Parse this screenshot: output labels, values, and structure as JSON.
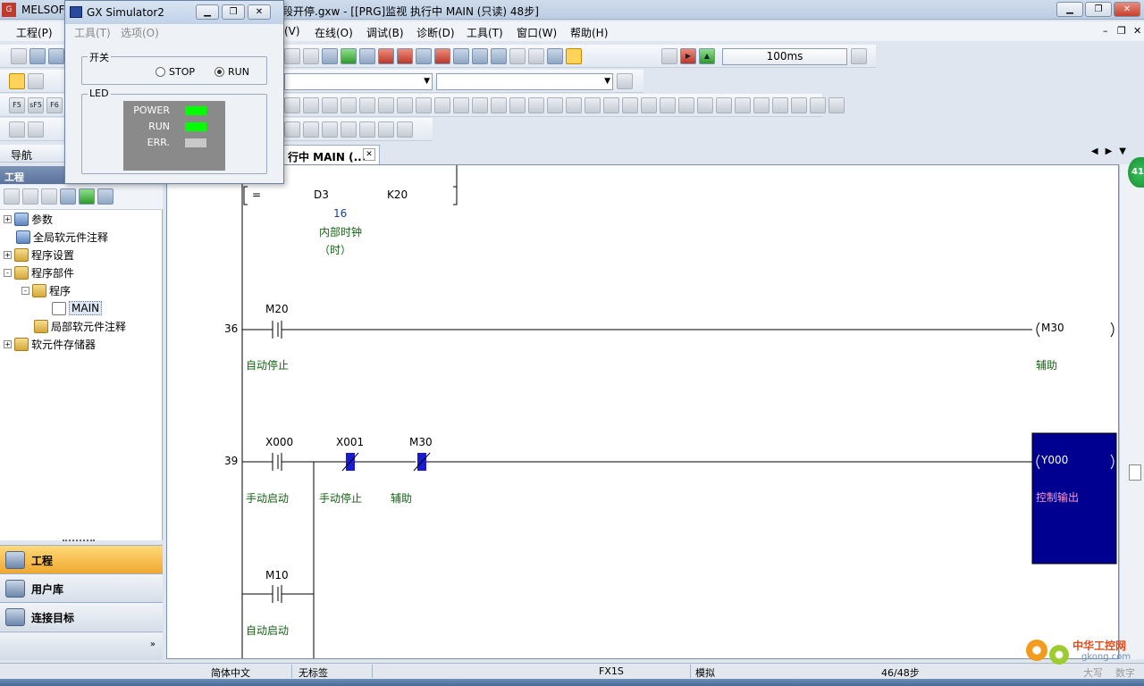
{
  "window": {
    "title_left": "MELSOF",
    "title_main": "段开停.gxw - [[PRG]监视 执行中 MAIN (只读) 48步]"
  },
  "menu": {
    "items": [
      {
        "label": "工程(P)"
      },
      {
        "label": "(V)"
      },
      {
        "label": "在线(O)"
      },
      {
        "label": "调试(B)"
      },
      {
        "label": "诊断(D)"
      },
      {
        "label": "工具(T)"
      },
      {
        "label": "窗口(W)"
      },
      {
        "label": "帮助(H)"
      }
    ]
  },
  "toolbar": {
    "scan_time": "100ms",
    "row3_labels": [
      "F5",
      "sF5",
      "F6"
    ]
  },
  "simulator": {
    "title": "GX Simulator2",
    "menu": [
      "工具(T)",
      "选项(O)"
    ],
    "switch_group": "开关",
    "stop_label": "STOP",
    "run_label": "RUN",
    "selected": "RUN",
    "led_group": "LED",
    "leds": [
      {
        "name": "POWER",
        "color": "#00ff00"
      },
      {
        "name": "RUN",
        "color": "#00ff00"
      },
      {
        "name": "ERR.",
        "color": "#c8c8c8"
      }
    ]
  },
  "nav": {
    "header": "导航",
    "project_header": "工程",
    "tree": [
      {
        "label": "参数",
        "level": 0,
        "expander": "+"
      },
      {
        "label": "全局软元件注释",
        "level": 0,
        "expander": ""
      },
      {
        "label": "程序设置",
        "level": 0,
        "expander": "+"
      },
      {
        "label": "程序部件",
        "level": 0,
        "expander": "-"
      },
      {
        "label": "程序",
        "level": 1,
        "expander": "-"
      },
      {
        "label": "MAIN",
        "level": 2,
        "expander": ""
      },
      {
        "label": "局部软元件注释",
        "level": 1,
        "expander": ""
      },
      {
        "label": "软元件存储器",
        "level": 0,
        "expander": "+"
      }
    ],
    "tabs": [
      {
        "label": "工程"
      },
      {
        "label": "用户库"
      },
      {
        "label": "连接目标"
      }
    ],
    "more": "»"
  },
  "doc_tab": {
    "label": "行中 MAIN (...",
    "close": "✕"
  },
  "ladder": {
    "compare": {
      "op": "=",
      "a": "D3",
      "b": "K20",
      "value": "16",
      "comment_1": "内部时钟",
      "comment_2": "（时）"
    },
    "rung36": {
      "step": "36",
      "contact": "M20",
      "contact_comment": "自动停止",
      "coil": "M30",
      "coil_comment": "辅助"
    },
    "rung39": {
      "step": "39",
      "c1": "X000",
      "c1_comment": "手动启动",
      "c2": "X001",
      "c2_comment": "手动停止",
      "c3": "M30",
      "c3_comment": "辅助",
      "branch": "M10",
      "branch_comment": "自动启动",
      "coil": "Y000",
      "coil_comment": "控制输出"
    }
  },
  "status": {
    "language": "简体中文",
    "label": "无标签",
    "cpu": "FX1S",
    "mode": "模拟",
    "steps": "46/48步",
    "caps": "大写",
    "num": "数字"
  },
  "watermark": {
    "cn": "中华工控网",
    "url": "gkong.com"
  },
  "badge": "41"
}
